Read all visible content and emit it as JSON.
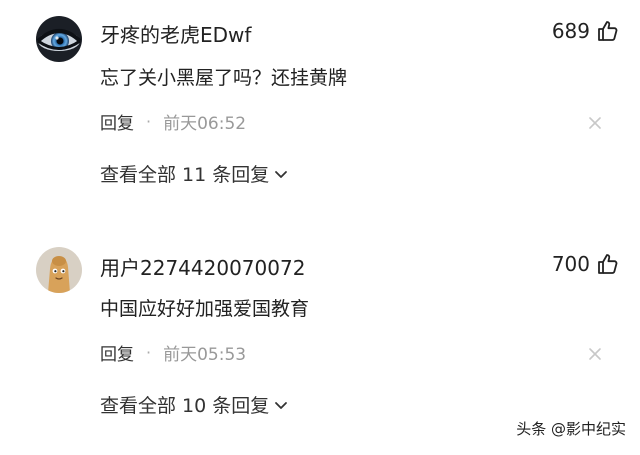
{
  "comments": [
    {
      "username": "牙疼的老虎EDwf",
      "likes": "689",
      "text": "忘了关小黑屋了吗？还挂黄牌",
      "reply_label": "回复",
      "separator": "·",
      "time": "前天06:52",
      "view_replies": "查看全部 11 条回复",
      "avatar_icon": "eye-avatar"
    },
    {
      "username": "用户2274420070072",
      "likes": "700",
      "text": "中国应好好加强爱国教育",
      "reply_label": "回复",
      "separator": "·",
      "time": "前天05:53",
      "view_replies": "查看全部 10 条回复",
      "avatar_icon": "cartoon-avatar"
    }
  ],
  "watermark": "头条 @影中纪实",
  "icons": {
    "like": "thumbs-up-icon",
    "dismiss": "close-icon",
    "expand": "chevron-down-icon"
  },
  "colors": {
    "text": "#222222",
    "muted": "#999999",
    "icon": "#cccccc"
  }
}
